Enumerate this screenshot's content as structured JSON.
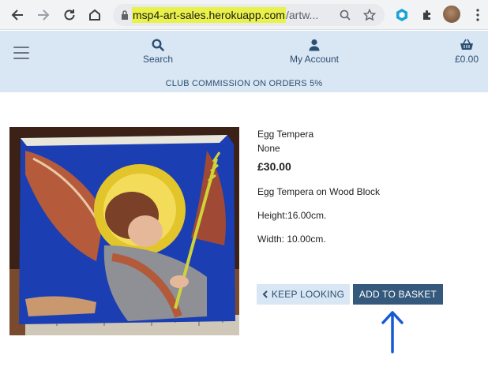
{
  "browser": {
    "url_host": "msp4-art-sales.herokuapp.com",
    "url_path": "/artw..."
  },
  "header": {
    "search_label": "Search",
    "account_label": "My Account",
    "basket_total": "£0.00",
    "banner": "CLUB COMMISSION ON ORDERS 5%"
  },
  "product": {
    "title": "Egg Tempera",
    "subtitle": "None",
    "price": "£30.00",
    "description": "Egg Tempera on Wood Block",
    "height": "Height:16.00cm.",
    "width": "Width: 10.00cm."
  },
  "actions": {
    "keep_looking": "KEEP LOOKING",
    "add_to_basket": "ADD TO BASKET"
  },
  "colors": {
    "header_bg": "#d9e6f3",
    "primary": "#34597d",
    "annotation_arrow": "#1559d6",
    "url_highlight": "#e9f24a"
  }
}
